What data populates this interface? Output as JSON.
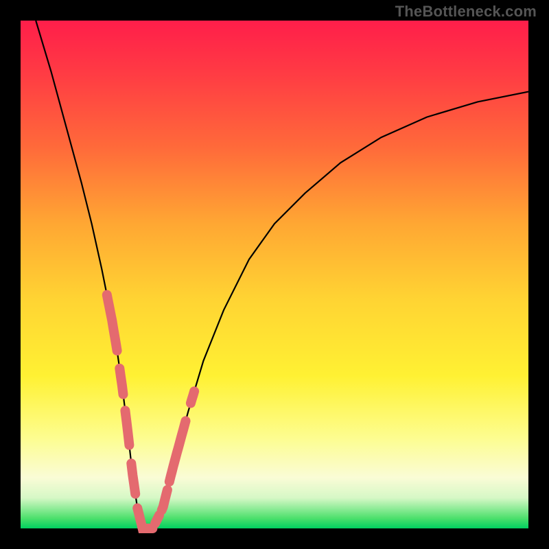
{
  "watermark": "TheBottleneck.com",
  "chart_data": {
    "type": "line",
    "title": "",
    "xlabel": "",
    "ylabel": "",
    "xlim": [
      0,
      100
    ],
    "ylim": [
      0,
      100
    ],
    "grid": false,
    "legend": false,
    "background_gradient": {
      "orientation": "vertical",
      "stops": [
        {
          "pos": 0.0,
          "color": "#ff1e4a"
        },
        {
          "pos": 0.25,
          "color": "#ff6a3a"
        },
        {
          "pos": 0.55,
          "color": "#ffd433"
        },
        {
          "pos": 0.82,
          "color": "#fdfd8e"
        },
        {
          "pos": 0.94,
          "color": "#d6f8c6"
        },
        {
          "pos": 1.0,
          "color": "#00d060"
        }
      ]
    },
    "series": [
      {
        "name": "curve",
        "x": [
          3,
          6,
          9,
          12,
          14,
          16,
          18,
          19,
          20,
          21,
          22,
          23,
          24,
          26,
          28,
          30,
          33,
          36,
          40,
          45,
          50,
          56,
          63,
          71,
          80,
          90,
          100
        ],
        "y": [
          100,
          90,
          79,
          68,
          60,
          51,
          41,
          35,
          28,
          20,
          11,
          4,
          0,
          0,
          4,
          12,
          23,
          33,
          43,
          53,
          60,
          66,
          72,
          77,
          81,
          84,
          86
        ]
      }
    ],
    "highlighted_segments": [
      {
        "x_range": [
          17,
          19
        ],
        "note": "left-branch-upper"
      },
      {
        "x_range": [
          19.5,
          20.2
        ],
        "note": "left-branch-dot-a"
      },
      {
        "x_range": [
          20.6,
          21.4
        ],
        "note": "left-branch-dot-b"
      },
      {
        "x_range": [
          21.8,
          22.6
        ],
        "note": "left-branch-lower"
      },
      {
        "x_range": [
          23,
          26
        ],
        "note": "trough"
      },
      {
        "x_range": [
          26.5,
          27.3
        ],
        "note": "right-branch-dot-a"
      },
      {
        "x_range": [
          27.8,
          28.9
        ],
        "note": "right-branch-dot-b"
      },
      {
        "x_range": [
          29.3,
          32.5
        ],
        "note": "right-branch-upper"
      },
      {
        "x_range": [
          33.5,
          34.2
        ],
        "note": "right-branch-dot-c"
      }
    ],
    "highlight_color": "#e46a6f"
  }
}
